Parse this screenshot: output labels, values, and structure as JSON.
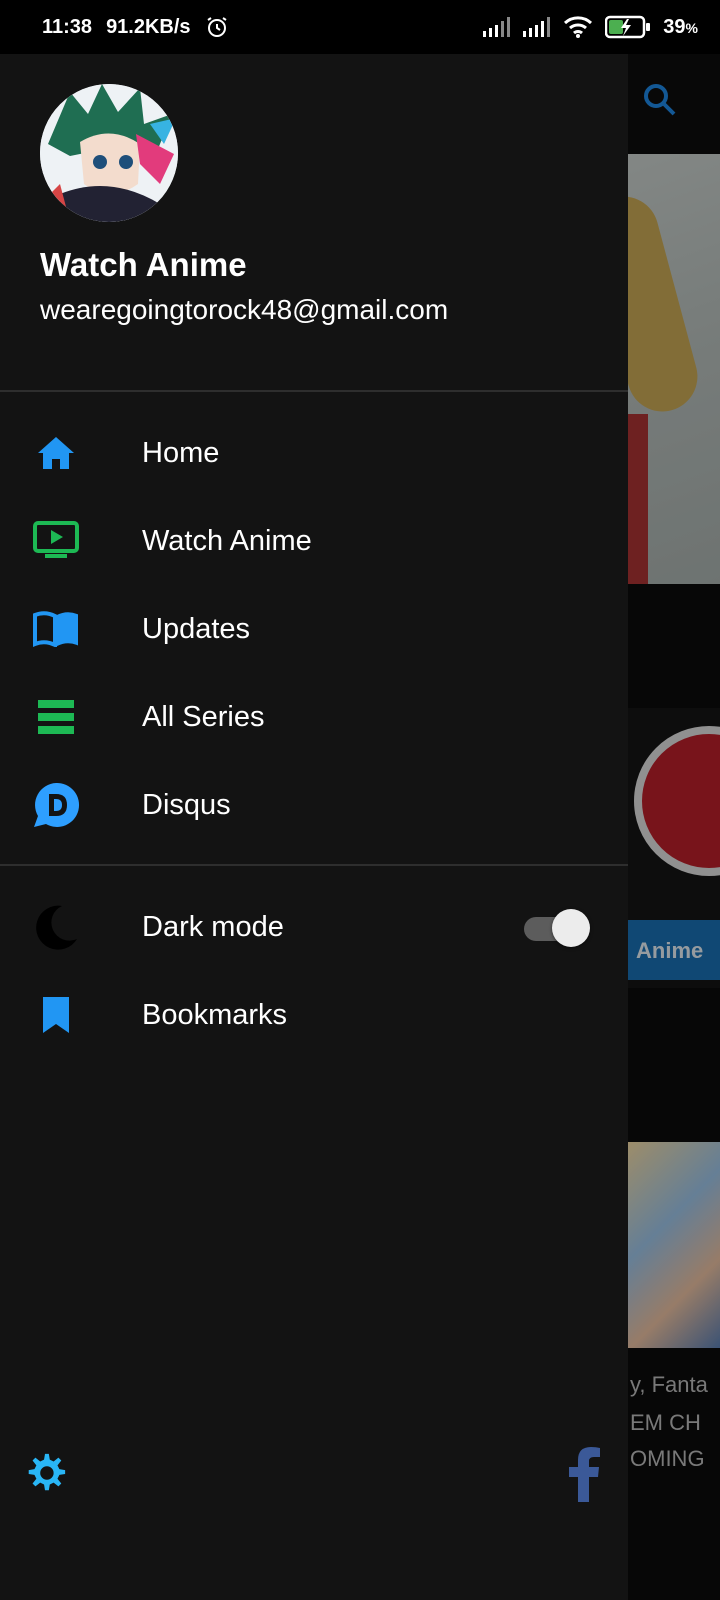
{
  "status_bar": {
    "time": "11:38",
    "net_speed": "91.2KB/s",
    "battery": "39",
    "battery_unit": "%"
  },
  "background": {
    "tag_label": "Anime",
    "text_line1": "y, Fanta",
    "text_line2": "EM CH",
    "text_line3": "OMING"
  },
  "drawer": {
    "user": {
      "name": "Watch Anime",
      "email": "wearegoingtorock48@gmail.com"
    },
    "menu": [
      {
        "label": "Home",
        "icon": "home-icon",
        "color": "#2196F3"
      },
      {
        "label": "Watch Anime",
        "icon": "tv-play-icon",
        "color": "#1DB954"
      },
      {
        "label": "Updates",
        "icon": "book-open-icon",
        "color": "#2196F3"
      },
      {
        "label": "All Series",
        "icon": "list-icon",
        "color": "#1DB954"
      },
      {
        "label": "Disqus",
        "icon": "disqus-icon",
        "color": "#2E9FFF"
      }
    ],
    "dark_mode": {
      "label": "Dark mode",
      "icon": "moon-icon",
      "enabled": true
    },
    "bookmarks": {
      "label": "Bookmarks",
      "icon": "bookmark-icon",
      "color": "#2196F3"
    }
  },
  "footer": {
    "settings_icon": "gear-icon",
    "facebook_icon": "facebook-icon",
    "settings_color": "#29B6F6",
    "facebook_color": "#3B5998"
  }
}
